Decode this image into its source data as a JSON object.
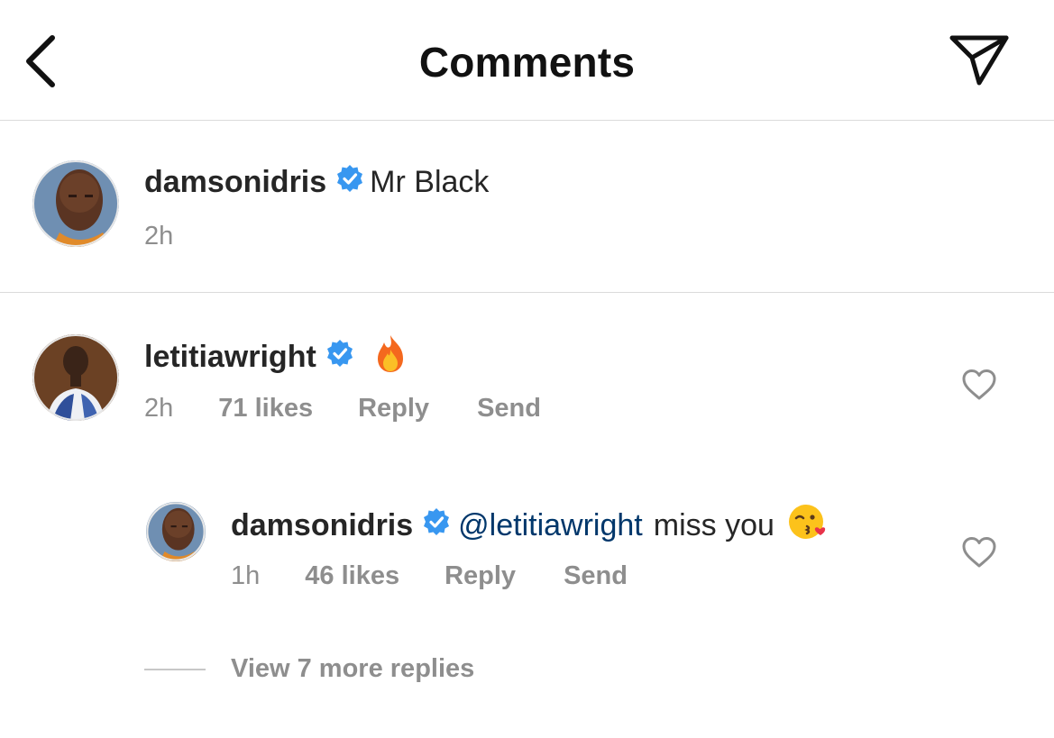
{
  "header": {
    "title": "Comments",
    "back_icon": "chevron-left-icon",
    "send_icon": "paper-plane-icon"
  },
  "caption": {
    "username": "damsonidris",
    "verified": true,
    "text": "Mr Black",
    "time": "2h"
  },
  "comments": [
    {
      "username": "letitiawright",
      "verified": true,
      "emoji_icon": "fire-emoji-icon",
      "time": "2h",
      "likes": "71 likes",
      "reply_label": "Reply",
      "send_label": "Send"
    }
  ],
  "replies": [
    {
      "username": "damsonidris",
      "verified": true,
      "mention": "@letitiawright",
      "text": "miss you",
      "emoji_icon": "kissing-face-emoji-icon",
      "time": "1h",
      "likes": "46 likes",
      "reply_label": "Reply",
      "send_label": "Send"
    }
  ],
  "view_more_replies": "View 7 more replies",
  "colors": {
    "verified_blue": "#3897f0",
    "mention_blue": "#00376b",
    "secondary_text": "#8e8e8e",
    "primary_text": "#262626",
    "divider": "#dbdbdb"
  }
}
